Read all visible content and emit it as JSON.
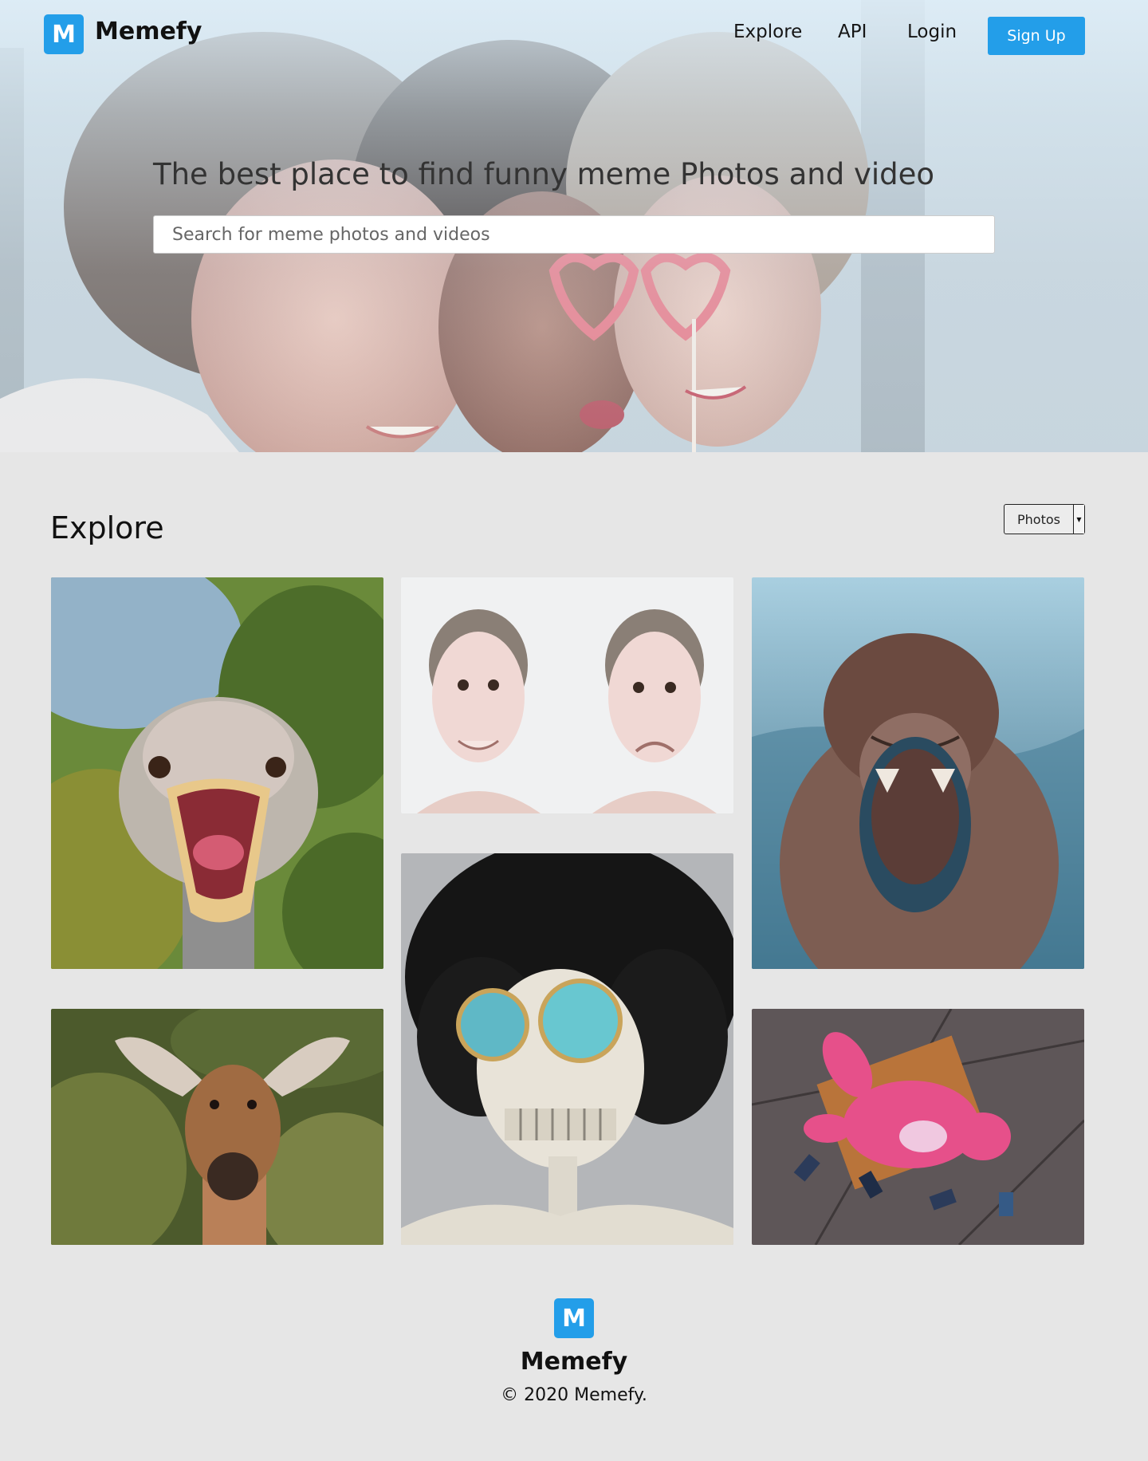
{
  "brand": {
    "logo_letter": "M",
    "name": "Memefy",
    "accent_color": "#239ee9"
  },
  "nav": {
    "explore": "Explore",
    "api": "API",
    "login": "Login",
    "signup": "Sign Up"
  },
  "hero": {
    "title": "The best place to find funny meme Photos and video",
    "search_placeholder": "Search for meme photos and videos",
    "search_value": ""
  },
  "explore": {
    "title": "Explore",
    "media_type_selected": "Photos",
    "tiles": [
      {
        "subject": "ostrich-open-beak"
      },
      {
        "subject": "man-two-faces"
      },
      {
        "subject": "monkey-yawning"
      },
      {
        "subject": "skeleton-afro-sunglasses"
      },
      {
        "subject": "antelope-portrait"
      },
      {
        "subject": "pink-panther-toy-bench"
      }
    ]
  },
  "footer": {
    "logo_letter": "M",
    "brand": "Memefy",
    "copyright": "© 2020 Memefy."
  }
}
